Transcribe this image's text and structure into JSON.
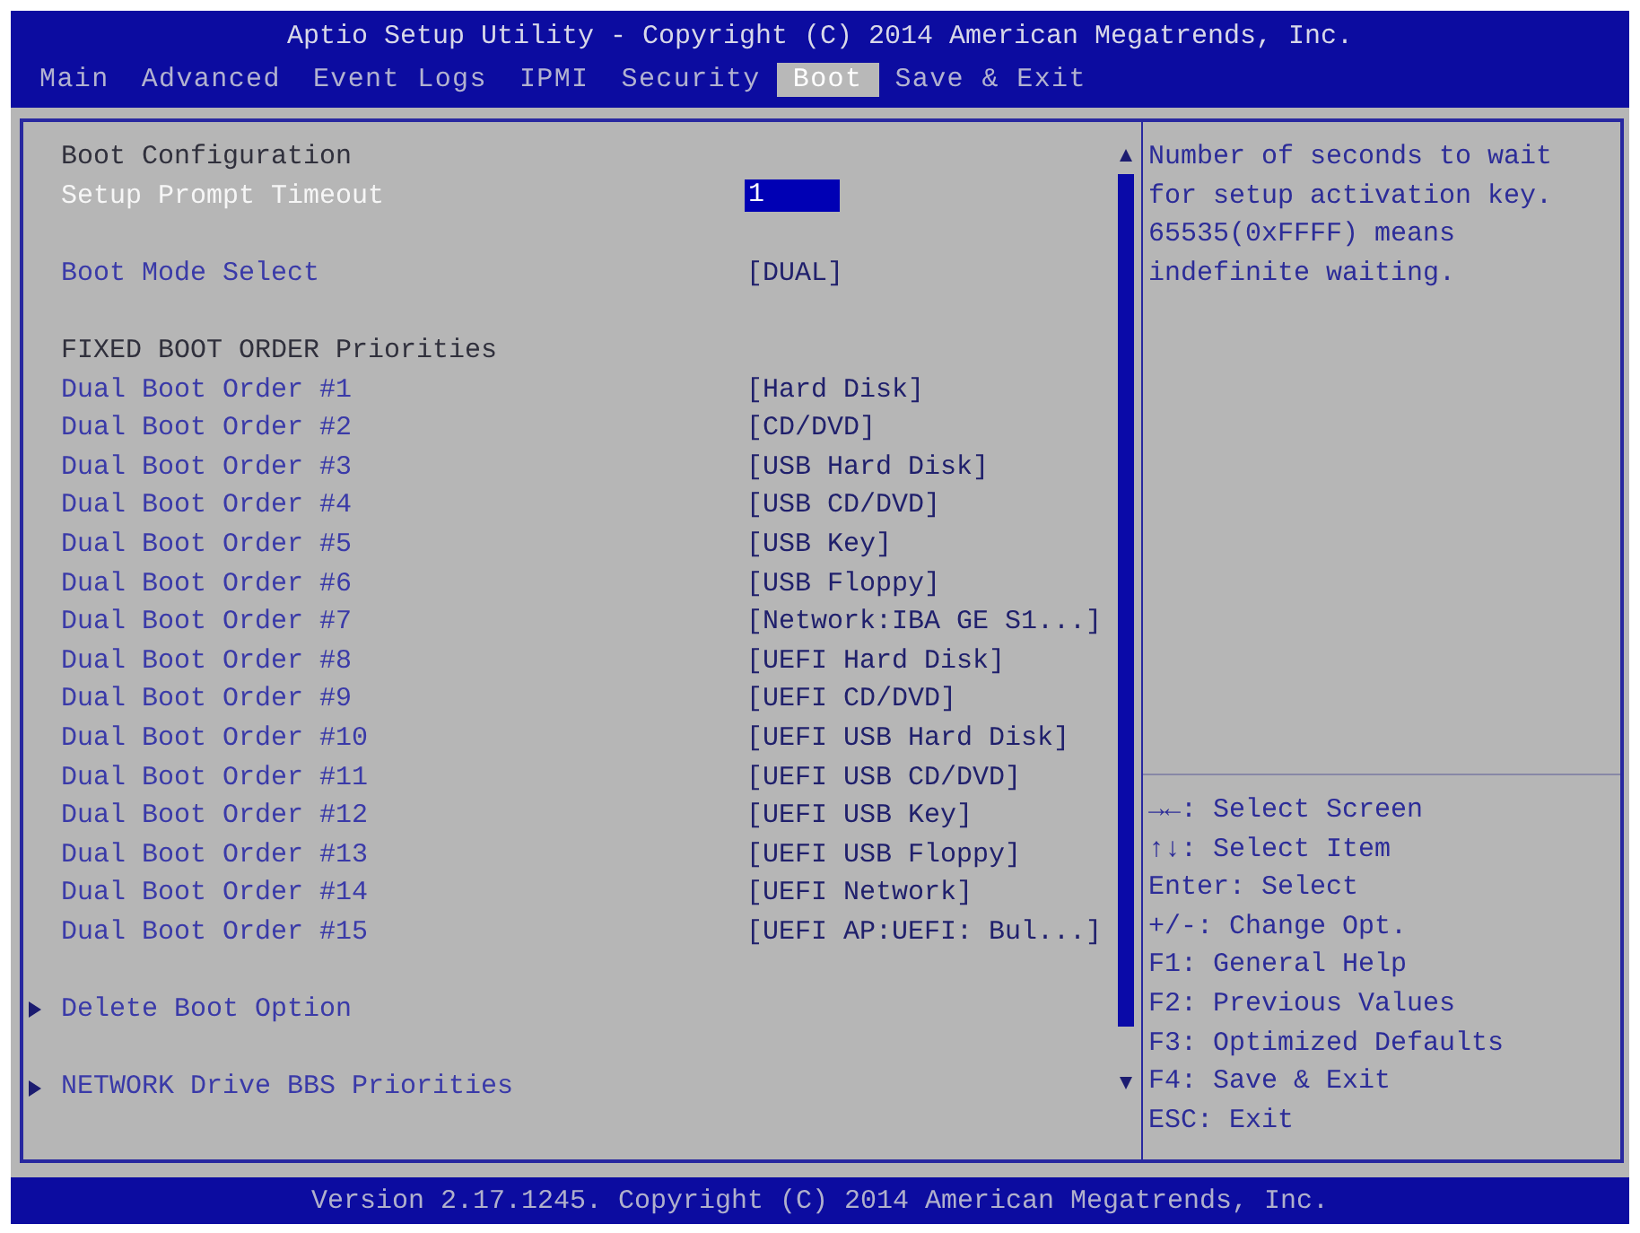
{
  "window": {
    "title": "Aptio Setup Utility - Copyright (C) 2014 American Megatrends, Inc."
  },
  "tabs": [
    {
      "label": "Main",
      "selected": false
    },
    {
      "label": "Advanced",
      "selected": false
    },
    {
      "label": "Event Logs",
      "selected": false
    },
    {
      "label": "IPMI",
      "selected": false
    },
    {
      "label": "Security",
      "selected": false
    },
    {
      "label": "Boot",
      "selected": true
    },
    {
      "label": "Save & Exit",
      "selected": false
    }
  ],
  "settings": {
    "sections": [
      {
        "heading": "Boot Configuration",
        "items": [
          {
            "kind": "number",
            "label": "Setup Prompt Timeout",
            "value": "1",
            "selected": true
          }
        ]
      },
      {
        "items": [
          {
            "kind": "option",
            "label": "Boot Mode Select",
            "value": "[DUAL]",
            "selected": false
          }
        ]
      },
      {
        "heading": "FIXED BOOT ORDER Priorities",
        "items": [
          {
            "kind": "option",
            "label": "Dual Boot Order #1",
            "value": "[Hard Disk]",
            "selected": false
          },
          {
            "kind": "option",
            "label": "Dual Boot Order #2",
            "value": "[CD/DVD]",
            "selected": false
          },
          {
            "kind": "option",
            "label": "Dual Boot Order #3",
            "value": "[USB Hard Disk]",
            "selected": false
          },
          {
            "kind": "option",
            "label": "Dual Boot Order #4",
            "value": "[USB CD/DVD]",
            "selected": false
          },
          {
            "kind": "option",
            "label": "Dual Boot Order #5",
            "value": "[USB Key]",
            "selected": false
          },
          {
            "kind": "option",
            "label": "Dual Boot Order #6",
            "value": "[USB Floppy]",
            "selected": false
          },
          {
            "kind": "option",
            "label": "Dual Boot Order #7",
            "value": "[Network:IBA GE S1...]",
            "selected": false
          },
          {
            "kind": "option",
            "label": "Dual Boot Order #8",
            "value": "[UEFI Hard Disk]",
            "selected": false
          },
          {
            "kind": "option",
            "label": "Dual Boot Order #9",
            "value": "[UEFI CD/DVD]",
            "selected": false
          },
          {
            "kind": "option",
            "label": "Dual Boot Order #10",
            "value": "[UEFI USB Hard Disk]",
            "selected": false
          },
          {
            "kind": "option",
            "label": "Dual Boot Order #11",
            "value": "[UEFI USB CD/DVD]",
            "selected": false
          },
          {
            "kind": "option",
            "label": "Dual Boot Order #12",
            "value": "[UEFI USB Key]",
            "selected": false
          },
          {
            "kind": "option",
            "label": "Dual Boot Order #13",
            "value": "[UEFI USB Floppy]",
            "selected": false
          },
          {
            "kind": "option",
            "label": "Dual Boot Order #14",
            "value": "[UEFI Network]",
            "selected": false
          },
          {
            "kind": "option",
            "label": "Dual Boot Order #15",
            "value": "[UEFI AP:UEFI: Bul...]",
            "selected": false
          }
        ]
      },
      {
        "items": [
          {
            "kind": "submenu",
            "label": "Delete Boot Option",
            "selected": false
          }
        ]
      },
      {
        "items": [
          {
            "kind": "submenu",
            "label": "NETWORK Drive BBS Priorities",
            "selected": false
          }
        ]
      }
    ]
  },
  "help": {
    "text": "Number of seconds to wait for setup activation key. 65535(0xFFFF) means indefinite waiting.",
    "keys": [
      "→←: Select Screen",
      "↑↓: Select Item",
      "Enter: Select",
      "+/-: Change Opt.",
      "F1: General Help",
      "F2: Previous Values",
      "F3: Optimized Defaults",
      "F4: Save & Exit",
      "ESC: Exit"
    ]
  },
  "status_bar": {
    "text": "Version 2.17.1245. Copyright (C) 2014 American Megatrends, Inc."
  }
}
